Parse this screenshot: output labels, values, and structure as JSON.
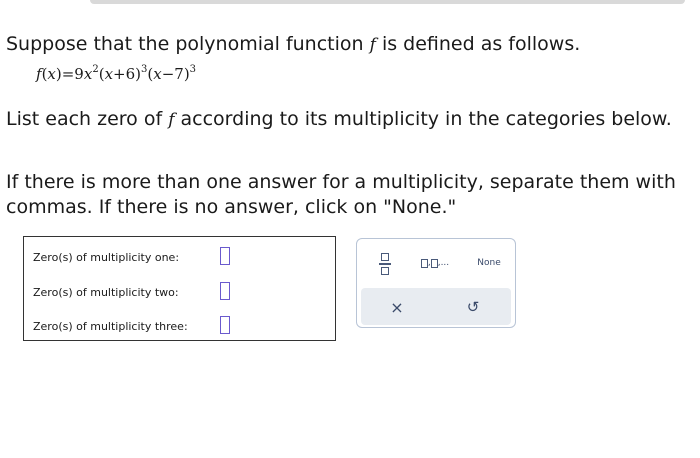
{
  "question": {
    "intro_before": "Suppose that the polynomial function ",
    "intro_f": "f",
    "intro_after": " is defined as follows.",
    "formula": {
      "f": "f",
      "open_x": "(",
      "x": "x",
      "close_eq": ")=9",
      "x2": "x",
      "exp2": "2",
      "part2": "(",
      "x3": "x",
      "part3": "+6)",
      "exp3": "3",
      "part4": "(",
      "x4": "x",
      "part5": "−7)",
      "exp5": "3"
    },
    "list_before": "List each zero of ",
    "list_f": "f",
    "list_after": " according to its multiplicity in the categories below.",
    "instruction_line1": "If there is more than one answer for a multiplicity, separate them with",
    "instruction_line2": "commas. If there is no answer, click on \"None.\""
  },
  "answers": {
    "rows": [
      {
        "label": "Zero(s) of multiplicity one:",
        "value": ""
      },
      {
        "label": "Zero(s) of multiplicity two:",
        "value": ""
      },
      {
        "label": "Zero(s) of multiplicity three:",
        "value": ""
      }
    ]
  },
  "tools": {
    "list_label_sep": ",",
    "list_label_end": ",...",
    "none_label": "None",
    "clear_symbol": "×",
    "undo_symbol": "↺",
    "accent_color": "#6a5acd"
  }
}
